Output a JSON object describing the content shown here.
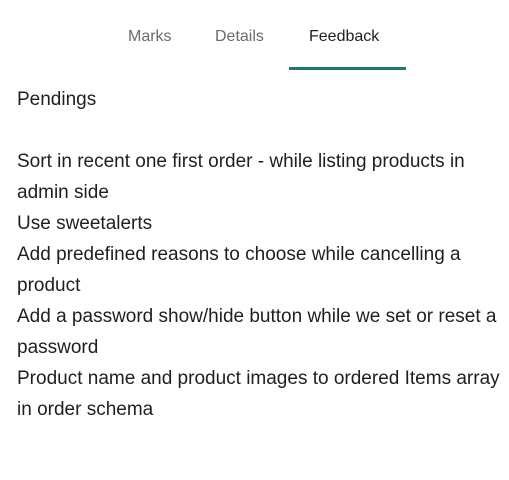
{
  "tabs": [
    {
      "label": "Marks"
    },
    {
      "label": "Details"
    },
    {
      "label": "Feedback",
      "active": true
    }
  ],
  "colors": {
    "accent": "#1e7a6e",
    "text": "#1f1f1f",
    "muted_tab": "#6b6b6b"
  },
  "feedback": {
    "heading": "Pendings",
    "items": [
      "Sort in recent one first order - while listing products in admin side",
      "Use sweetalerts",
      "Add predefined reasons to choose while cancelling a product",
      "Add a password show/hide button while we set or reset a password",
      "Product name and product images to ordered Items array in order schema"
    ]
  }
}
